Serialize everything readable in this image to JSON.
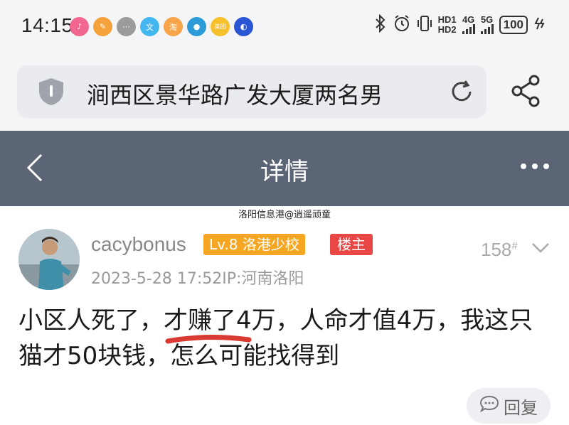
{
  "status_bar": {
    "time": "14:15",
    "app_icons": [
      {
        "name": "music-app-icon",
        "color": "#f2678f",
        "glyph": "♪"
      },
      {
        "name": "brush-app-icon",
        "color": "#f5a13c",
        "glyph": "✎"
      },
      {
        "name": "chat-app-icon",
        "color": "#9b9b9b",
        "glyph": "⋯"
      },
      {
        "name": "wenku-app-icon",
        "color": "#44b6f0",
        "glyph": "文"
      },
      {
        "name": "taobao-app-icon",
        "color": "#f7a44b",
        "glyph": "淘"
      },
      {
        "name": "ball-app-icon",
        "color": "#2d9bd8",
        "glyph": "●"
      },
      {
        "name": "meituan-app-icon",
        "color": "#f7c12b",
        "glyph": "美团"
      },
      {
        "name": "planet-app-icon",
        "color": "#2a56d4",
        "glyph": "◐"
      }
    ],
    "hd1": "HD1",
    "hd2": "HD2",
    "net1": "4G",
    "net2": "5G",
    "battery": "100"
  },
  "search": {
    "query": "涧西区景华路广发大厦两名男"
  },
  "header": {
    "title": "详情"
  },
  "watermark": "洛阳信息港@逍遥顽童",
  "post": {
    "username": "cacybonus",
    "level_badge": "Lv.8 洛港少校",
    "owner_badge": "楼主",
    "floor": "158",
    "floor_mark": "#",
    "meta": "2023-5-28 17:52IP:河南洛阳",
    "content": "小区人死了，才赚了4万，人命才值4万，我这只猫才50块钱，怎么可能找得到",
    "reply_label": "回复"
  },
  "colors": {
    "header_bg": "#5b6576",
    "level_badge_bg": "#f6a623",
    "owner_badge_bg": "#e94646",
    "underline": "#d93a32"
  }
}
